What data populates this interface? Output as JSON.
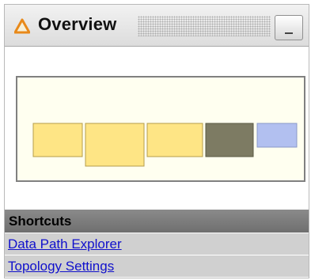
{
  "panel": {
    "title": "Overview",
    "title_icon": "warning-triangle-icon",
    "minimize_icon": "minimize-icon"
  },
  "overview": {
    "blocks": [
      {
        "color": "#fee585",
        "border": "#b59d4d"
      },
      {
        "color": "#fee585",
        "border": "#b59d4d"
      },
      {
        "color": "#fee585",
        "border": "#b59d4d"
      },
      {
        "color": "#7d7b63",
        "border": "#5a5945"
      },
      {
        "color": "#b2c0f0",
        "border": "#8a98c8"
      }
    ]
  },
  "shortcuts": {
    "header": "Shortcuts",
    "items": [
      {
        "label": "Data Path Explorer"
      },
      {
        "label": "Topology Settings"
      }
    ]
  },
  "colors": {
    "link": "#1010cc",
    "warning": "#e8891a",
    "section_header": "#7a7a7a",
    "row_bg": "#d0d0d0",
    "overview_bg": "#fffff0"
  }
}
